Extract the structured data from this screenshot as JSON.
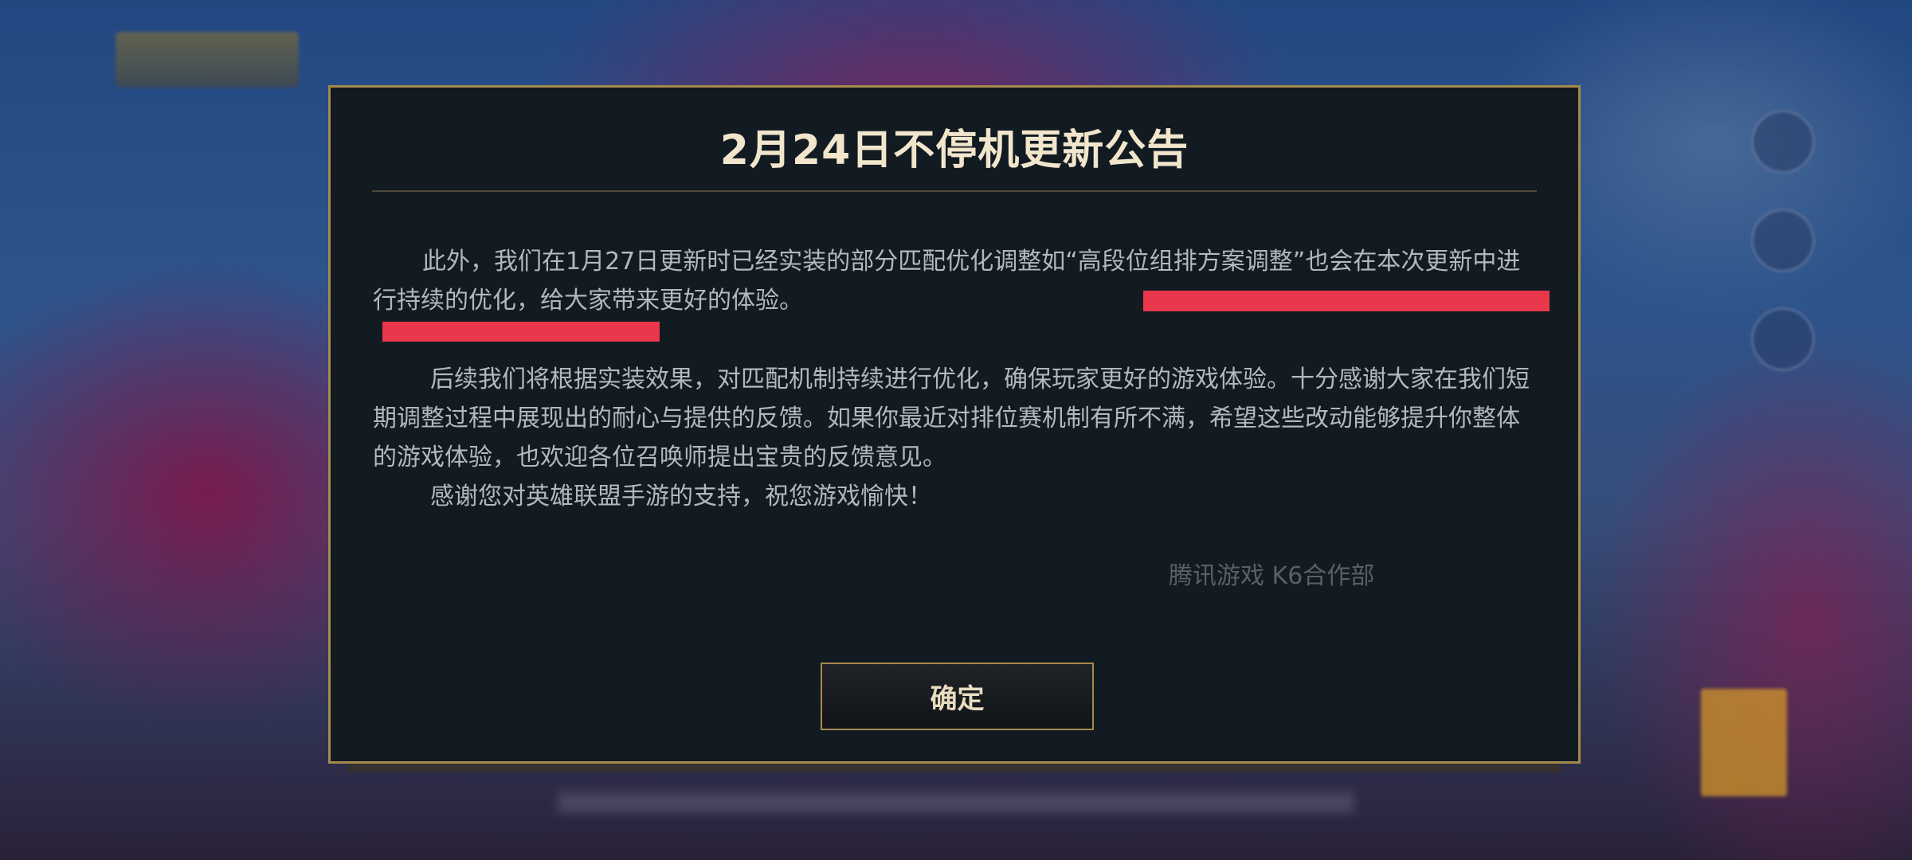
{
  "dialog": {
    "title": "2月24日不停机更新公告",
    "paragraphs": [
      "此外，我们在1月27日更新时已经实装的部分匹配优化调整如“高段位组排方案调整”也会在本次更新中进行持续的优化，给大家带来更好的体验。",
      "后续我们将根据实装效果，对匹配机制持续进行优化，确保玩家更好的游戏体验。十分感谢大家在我们短期调整过程中展现出的耐心与提供的反馈。如果你最近对排位赛机制有所不满，希望这些改动能够提升你整体的游戏体验，也欢迎各位召唤师提出宝贵的反馈意见。",
      "感谢您对英雄联盟手游的支持，祝您游戏愉快！"
    ],
    "signature": "腾讯游戏 K6合作部",
    "confirm_label": "确定"
  },
  "colors": {
    "dialog_background": "#121a22",
    "border_gold": "#a48a4c",
    "title_text": "#f1e6cc",
    "body_text": "#b4b8ba",
    "highlight_mark": "#e9374c"
  }
}
